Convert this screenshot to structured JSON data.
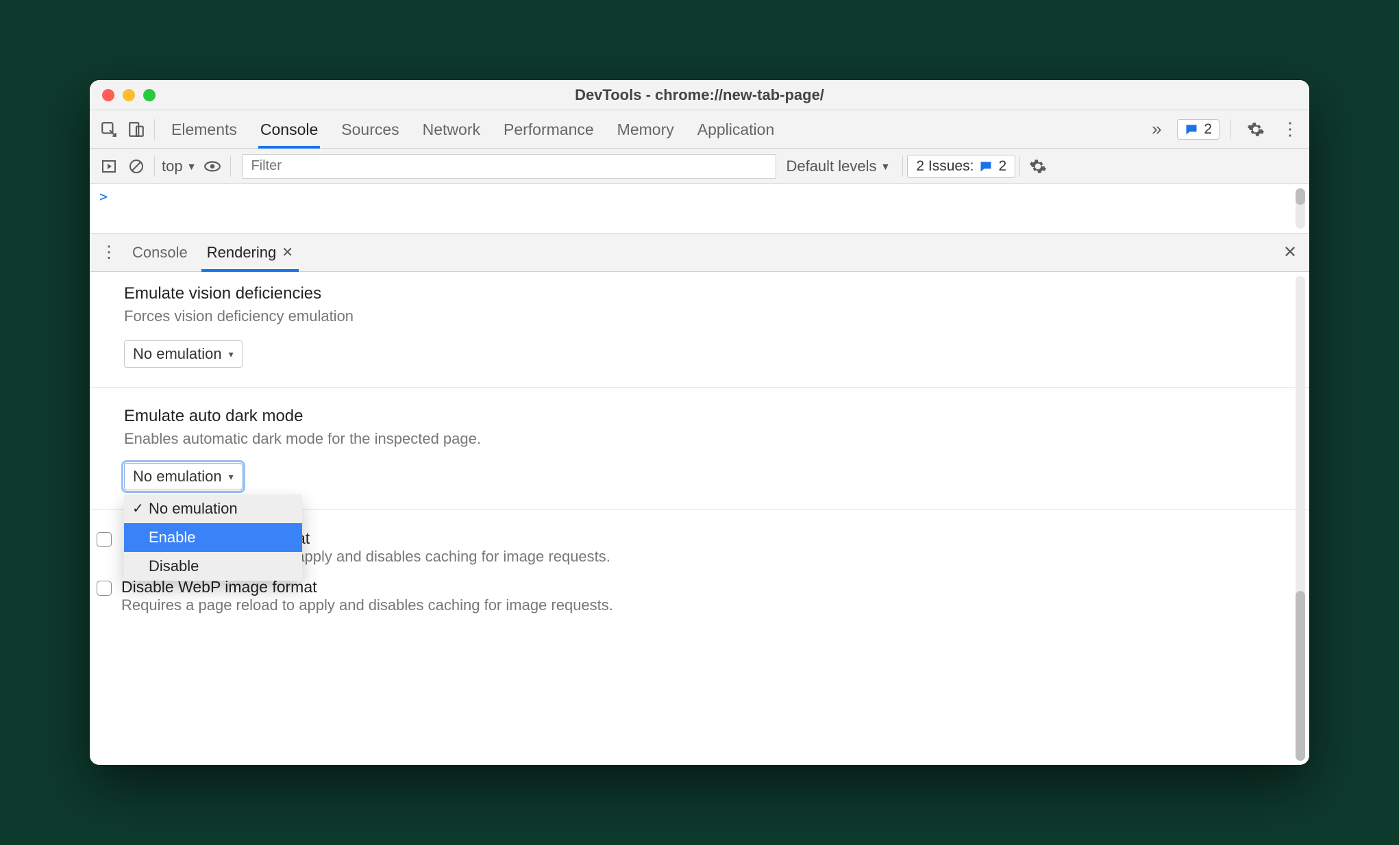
{
  "window": {
    "title": "DevTools - chrome://new-tab-page/"
  },
  "main_tabs": {
    "items": [
      "Elements",
      "Console",
      "Sources",
      "Network",
      "Performance",
      "Memory",
      "Application"
    ],
    "active_index": 1,
    "badge_count": "2"
  },
  "console_toolbar": {
    "context": "top",
    "filter_placeholder": "Filter",
    "levels_label": "Default levels",
    "issues_label": "2 Issues:",
    "issues_count": "2"
  },
  "console_prompt": ">",
  "drawer": {
    "tabs": [
      "Console",
      "Rendering"
    ],
    "active_index": 1
  },
  "rendering": {
    "vision": {
      "title": "Emulate vision deficiencies",
      "desc": "Forces vision deficiency emulation",
      "select_value": "No emulation"
    },
    "dark": {
      "title": "Emulate auto dark mode",
      "desc": "Enables automatic dark mode for the inspected page.",
      "select_value": "No emulation",
      "options": [
        "No emulation",
        "Enable",
        "Disable"
      ],
      "checked_index": 0,
      "hover_index": 1
    },
    "avif": {
      "label": "format",
      "desc_suffix": "oad to apply and disables caching for image requests."
    },
    "webp": {
      "label": "Disable WebP image format",
      "desc": "Requires a page reload to apply and disables caching for image requests."
    }
  }
}
